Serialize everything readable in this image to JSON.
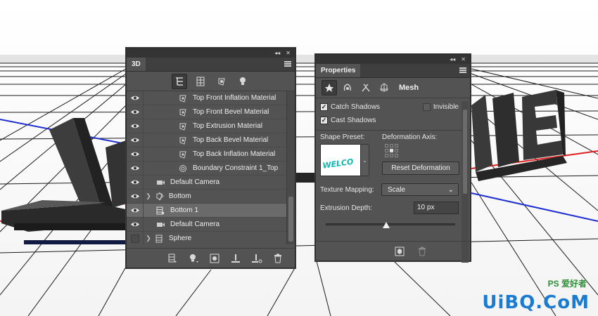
{
  "panel3d": {
    "title": "3D",
    "layers": [
      {
        "label": "Top Front Inflation Material",
        "visible": true,
        "type": "material"
      },
      {
        "label": "Top Front Bevel Material",
        "visible": true,
        "type": "material"
      },
      {
        "label": "Top Extrusion Material",
        "visible": true,
        "type": "material"
      },
      {
        "label": "Top Back Bevel Material",
        "visible": true,
        "type": "material"
      },
      {
        "label": "Top Back Inflation Material",
        "visible": true,
        "type": "material"
      },
      {
        "label": "Boundary Constraint 1_Top",
        "visible": true,
        "type": "constraint"
      },
      {
        "label": "Default Camera",
        "visible": true,
        "type": "camera"
      },
      {
        "label": "Bottom",
        "visible": true,
        "type": "group"
      },
      {
        "label": "Bottom 1",
        "visible": true,
        "type": "mesh",
        "selected": true
      },
      {
        "label": "Default Camera",
        "visible": true,
        "type": "camera"
      },
      {
        "label": "Sphere",
        "visible": false,
        "type": "group"
      }
    ]
  },
  "properties": {
    "title": "Properties",
    "tab_label": "Mesh",
    "catch_shadows": "Catch Shadows",
    "invisible": "Invisible",
    "cast_shadows": "Cast Shadows",
    "shape_preset_label": "Shape Preset:",
    "deformation_axis_label": "Deformation Axis:",
    "reset_deformation": "Reset Deformation",
    "texture_mapping_label": "Texture Mapping:",
    "texture_mapping_value": "Scale",
    "extrusion_depth_label": "Extrusion Depth:",
    "extrusion_depth_value": "10 px",
    "extrusion_slider_fraction": 0.47,
    "preset_thumb_text": "WELCO"
  },
  "scene": {
    "letters_left": "W",
    "letters_right": "ME"
  },
  "watermark": {
    "logo": "UiBQ.CoM",
    "tag": "PS 爱好者"
  },
  "colors": {
    "panel_bg": "#535353",
    "x_axis": "#e02020",
    "z_axis": "#1e2fd0",
    "thumb_text": "#13b5b0"
  }
}
